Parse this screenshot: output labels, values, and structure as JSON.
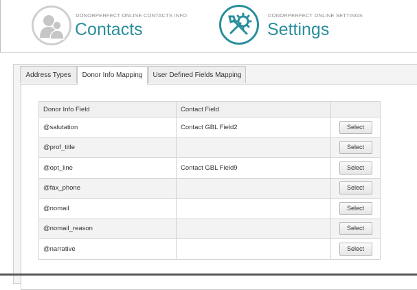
{
  "header": {
    "contacts": {
      "small": "DONORPERFECT ONLINE CONTACTS INFO",
      "big": "Contacts",
      "icon": "contacts-icon"
    },
    "settings": {
      "small": "DONORPERFECT ONLINE SETTINGS",
      "big": "Settings",
      "icon": "settings-icon"
    }
  },
  "colors": {
    "accent": "#2a8e9c",
    "inactive": "#c6c6c6"
  },
  "tabs": [
    {
      "label": "Address Types"
    },
    {
      "label": "Donor Info Mapping"
    },
    {
      "label": "User Defined Fields Mapping"
    }
  ],
  "table": {
    "headers": [
      "Donor Info Field",
      "Contact Field",
      ""
    ],
    "rows": [
      {
        "field": "@salutation",
        "contact": "Contact GBL Field2",
        "button": "Select"
      },
      {
        "field": "@prof_title",
        "contact": "",
        "button": "Select"
      },
      {
        "field": "@opt_line",
        "contact": "Contact GBL Field9",
        "button": "Select"
      },
      {
        "field": "@fax_phone",
        "contact": "",
        "button": "Select"
      },
      {
        "field": "@nomail",
        "contact": "",
        "button": "Select"
      },
      {
        "field": "@nomail_reason",
        "contact": "",
        "button": "Select"
      },
      {
        "field": "@narrative",
        "contact": "",
        "button": "Select"
      }
    ]
  }
}
